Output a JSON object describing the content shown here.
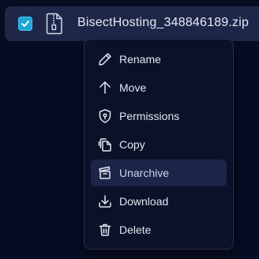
{
  "file": {
    "name": "BisectHosting_348846189.zip",
    "checked": true,
    "icon": "zip-file-icon"
  },
  "menu": {
    "items": [
      {
        "label": "Rename",
        "icon": "pencil-icon"
      },
      {
        "label": "Move",
        "icon": "arrow-up-icon"
      },
      {
        "label": "Permissions",
        "icon": "shield-icon"
      },
      {
        "label": "Copy",
        "icon": "copy-icon"
      },
      {
        "label": "Unarchive",
        "icon": "unarchive-icon",
        "highlighted": true
      },
      {
        "label": "Download",
        "icon": "download-icon"
      },
      {
        "label": "Delete",
        "icon": "trash-icon"
      }
    ]
  },
  "colors": {
    "background": "#070c22",
    "row": "#1e2748",
    "checkbox": "#1ea4d4",
    "menu": "#0b1128",
    "menu_highlight": "#1c2547"
  }
}
